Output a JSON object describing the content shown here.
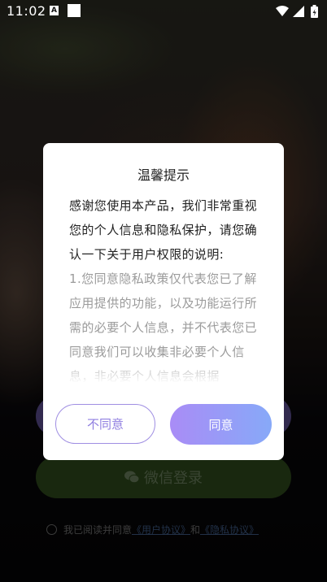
{
  "status_bar": {
    "time": "11:02",
    "notification_icon": "A"
  },
  "dialog": {
    "title": "温馨提示",
    "intro": "感谢您使用本产品，我们非常重视您的个人信息和隐私保护，请您确认一下关于用户权限的说明:",
    "policy": "1.您同意隐私政策仅代表您已了解应用提供的功能，以及功能运行所需的必要个人信息，并不代表您已同意我们可以收集非必要个人信息，非必要个人信息会根据",
    "decline_label": "不同意",
    "agree_label": "同意"
  },
  "login": {
    "wechat_label": "微信登录",
    "agreement_prefix": "我已阅读并同意",
    "user_agreement": "《用户协议》",
    "and": "和",
    "privacy_policy": "《隐私协议》"
  },
  "colors": {
    "accent_start": "#a98cf6",
    "accent_end": "#87a9f8",
    "decline_border": "#9f8ee2",
    "wechat_green": "#2e4a1c",
    "link": "#3e5a84"
  }
}
